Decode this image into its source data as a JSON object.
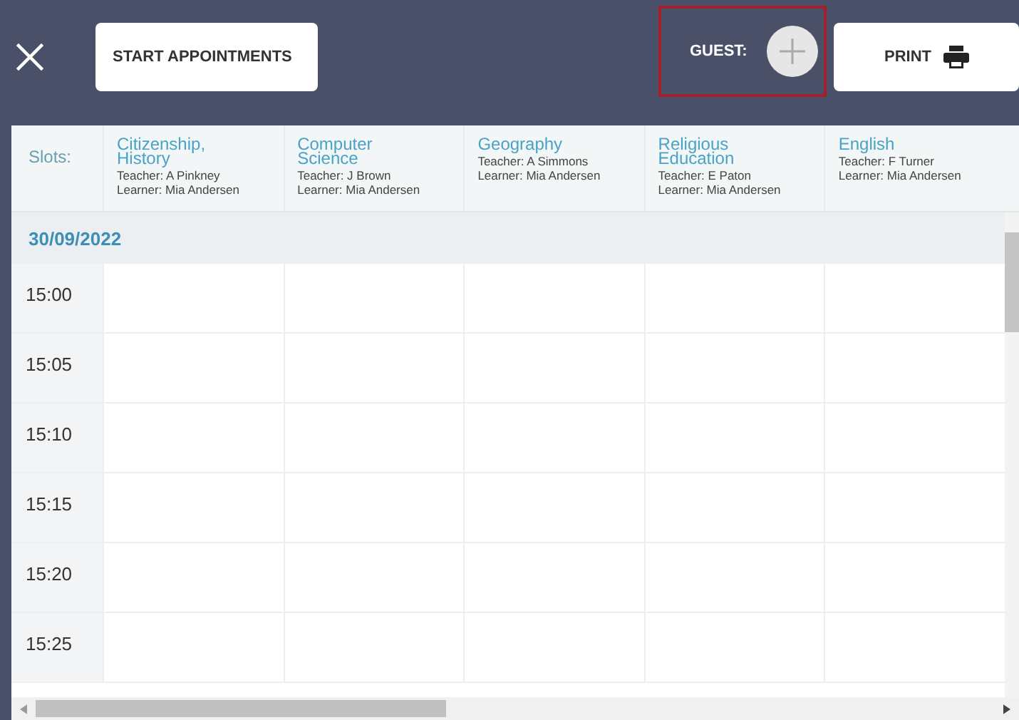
{
  "toolbar": {
    "start_button": "START APPOINTMENTS",
    "guest_label": "GUEST:",
    "print_button": "PRINT"
  },
  "slots_label": "Slots:",
  "columns": [
    {
      "subject": "Citizenship, History",
      "teacher": "Teacher: A Pinkney",
      "learner": "Learner: Mia Andersen"
    },
    {
      "subject": "Computer Science",
      "teacher": "Teacher: J Brown",
      "learner": "Learner: Mia Andersen"
    },
    {
      "subject": "Geography",
      "teacher": "Teacher: A Simmons",
      "learner": "Learner: Mia Andersen"
    },
    {
      "subject": "Religious Education",
      "teacher": "Teacher: E Paton",
      "learner": "Learner: Mia Andersen"
    },
    {
      "subject": "English",
      "teacher": "Teacher: F Turner",
      "learner": "Learner: Mia Andersen"
    }
  ],
  "date": "30/09/2022",
  "times": [
    "15:00",
    "15:05",
    "15:10",
    "15:15",
    "15:20",
    "15:25"
  ]
}
